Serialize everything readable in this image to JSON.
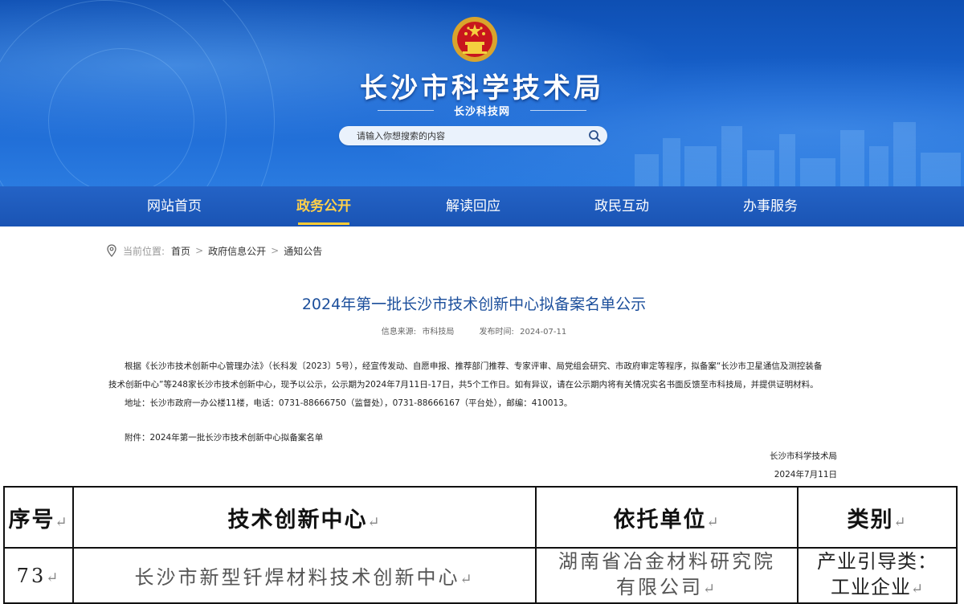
{
  "header": {
    "title": "长沙市科学技术局",
    "subtitle": "长沙科技网",
    "search_placeholder": "请输入你想搜索的内容"
  },
  "nav": {
    "items": [
      {
        "label": "网站首页"
      },
      {
        "label": "政务公开",
        "active": true
      },
      {
        "label": "解读回应"
      },
      {
        "label": "政民互动"
      },
      {
        "label": "办事服务"
      }
    ]
  },
  "breadcrumb": {
    "label": "当前位置:",
    "items": [
      "首页",
      "政府信息公开",
      "通知公告"
    ],
    "separator": ">"
  },
  "article": {
    "title": "2024年第一批长沙市技术创新中心拟备案名单公示",
    "source_label": "信息来源:",
    "source": "市科技局",
    "date_label": "发布时间:",
    "date": "2024-07-11",
    "paragraph1_line1": "根据《长沙市技术创新中心管理办法》（长科发〔2023〕5号），经宣传发动、自愿申报、推荐部门推荐、专家评审、局党组会研究、市政府审定等程序，拟备案“长沙市卫星通信及测控装备",
    "paragraph1_line2": "技术创新中心”等248家长沙市技术创新中心，现予以公示，公示期为2024年7月11日-17日，共5个工作日。如有异议，请在公示期内将有关情况实名书面反馈至市科技局，并提供证明材料。",
    "address": "地址：长沙市政府一办公楼11楼，电话：0731-88666750（监督处），0731-88666167（平台处），邮编：410013。",
    "attachment": "附件：2024年第一批长沙市技术创新中心拟备案名单",
    "signature": "长沙市科学技术局",
    "sign_date": "2024年7月11日"
  },
  "table": {
    "headers": [
      "序号",
      "技术创新中心",
      "依托单位",
      "类别"
    ],
    "rows": [
      [
        "73",
        "长沙市新型钎焊材料技术创新中心",
        "湖南省冶金材料研究院有限公司",
        "产业引导类：工业企业"
      ]
    ],
    "row_unit_line1": "湖南省冶金材料研究院",
    "row_unit_line2": "有限公司",
    "row_cat_line1": "产业引导类：",
    "row_cat_line2": "工业企业"
  },
  "icons": {
    "emblem": "national-emblem-icon",
    "search": "search-icon",
    "location": "location-pin-icon"
  },
  "colors": {
    "banner_blue": "#1a66d2",
    "nav_blue": "#1a54b4",
    "nav_active": "#ffd04a",
    "title_blue": "#1b4e9b"
  }
}
